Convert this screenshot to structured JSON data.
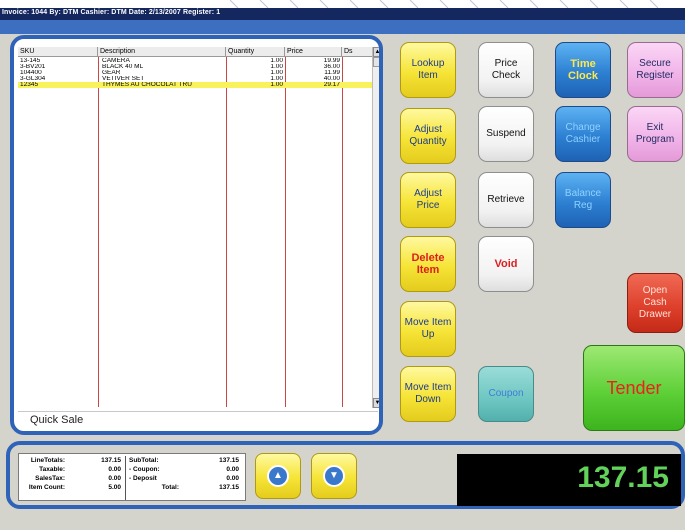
{
  "header": {
    "title": "Invoice: 1044  By: DTM  Cashier: DTM  Date: 2/13/2007  Register: 1"
  },
  "items": {
    "columns": [
      "SKU",
      "Description",
      "Quantity",
      "Price",
      "Ds"
    ],
    "rows": [
      {
        "sku": "13-145",
        "description": "CAMERA",
        "quantity": "1.00",
        "price": "19.99",
        "selected": false
      },
      {
        "sku": "3-BV201",
        "description": "BLACK 40 ML",
        "quantity": "1.00",
        "price": "36.00",
        "selected": false
      },
      {
        "sku": "104400",
        "description": "GEAR",
        "quantity": "1.00",
        "price": "11.99",
        "selected": false
      },
      {
        "sku": "3-GL304",
        "description": "VETIVER SET",
        "quantity": "1.00",
        "price": "40.00",
        "selected": false
      },
      {
        "sku": "12345",
        "description": "THYMES AU CHOCOLAT TRU",
        "quantity": "1.00",
        "price": "29.17",
        "selected": true
      }
    ],
    "footer_label": "Quick Sale"
  },
  "buttons": {
    "lookup_item": "Lookup\nItem",
    "adjust_quantity": "Adjust\nQuantity",
    "adjust_price": "Adjust\nPrice",
    "delete_item": "Delete\nItem",
    "move_item_up": "Move Item\nUp",
    "move_item_down": "Move Item\nDown",
    "price_check": "Price\nCheck",
    "suspend": "Suspend",
    "retrieve": "Retrieve",
    "void": "Void",
    "coupon": "Coupon",
    "time_clock": "Time\nClock",
    "change_cashier": "Change\nCashier",
    "balance_reg": "Balance\nReg",
    "secure_register": "Secure\nRegister",
    "exit_program": "Exit\nProgram",
    "open_cash_drawer": "Open\nCash\nDrawer",
    "tender": "Tender"
  },
  "totals": {
    "line_totals_label": "LineTotals:",
    "line_totals": "137.15",
    "taxable_label": "Taxable:",
    "taxable": "0.00",
    "sales_tax_label": "SalesTax:",
    "sales_tax": "0.00",
    "item_count_label": "Item Count:",
    "item_count": "5.00",
    "subtotal_label": "SubTotal:",
    "subtotal": "137.15",
    "coupon_label": "- Coupon:",
    "coupon": "0.00",
    "deposit_label": "- Deposit",
    "deposit": "0.00",
    "total_label": "Total:",
    "total": "137.15"
  },
  "display": {
    "total": "137.15"
  },
  "icons": {
    "arrow_up": "up-arrow-icon",
    "arrow_down": "down-arrow-icon"
  },
  "colors": {
    "panel_border": "#2f63b8",
    "selected_row": "#f8f25c",
    "total_display_text": "#62d25a",
    "title_bar": "#14275e"
  }
}
